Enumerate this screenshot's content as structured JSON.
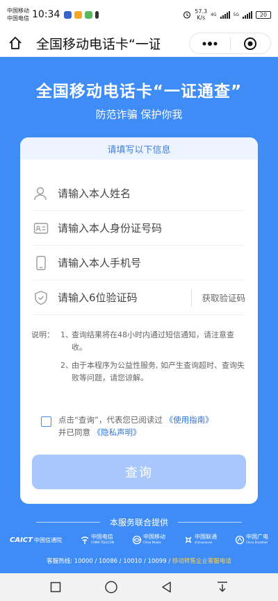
{
  "status": {
    "carrier1": "中国移动",
    "carrier2": "中国电信",
    "time": "10:34",
    "speed_value": "57.3",
    "speed_unit": "K/s",
    "net1": "4G",
    "net2": "5G",
    "battery": "20"
  },
  "nav": {
    "title": "全国移动电话卡“一证通查”",
    "more_icon": "more-dots-icon",
    "close_icon": "target-close-icon"
  },
  "hero": {
    "title": "全国移动电话卡“一证通查”",
    "subtitle": "防范诈骗 保护你我"
  },
  "form": {
    "header": "请填写以下信息",
    "name_placeholder": "请输入本人姓名",
    "id_placeholder": "请输入本人身份证号码",
    "phone_placeholder": "请输入本人手机号",
    "code_placeholder": "请输入6位验证码",
    "get_code": "获取验证码"
  },
  "notes": {
    "label": "说明：",
    "items": [
      {
        "num": "1、",
        "text": "查询结果将在48小时内通过短信通知，请注意查收。"
      },
      {
        "num": "2、",
        "text": "由于本程序为公益性服务, 如产生查询超时、查询失败等问题，请您谅解。"
      }
    ]
  },
  "agreement": {
    "prefix": "点击“查询”，代表您已阅读过 ",
    "link1": "《使用指南》",
    "middle": "并已同意 ",
    "link2": "《隐私声明》"
  },
  "query_button": "查询",
  "footer": {
    "provided_by": "本服务联合提供",
    "logos": [
      {
        "name": "CAICT",
        "cn": "中国信通院"
      },
      {
        "name": "中国电信",
        "cn": "CHINA TELECOM"
      },
      {
        "name": "中国移动",
        "cn": "China Mobile"
      },
      {
        "name": "中国联通",
        "cn": "chinaunicom"
      },
      {
        "name": "中国广电",
        "cn": "China Broadnet"
      }
    ],
    "hotline": "客服热线: 10000 / 10086 / 10010 / 10099 / ",
    "hotline_link": "移动转售企业客服电话"
  },
  "colors": {
    "primary": "#3f8cf6",
    "button_disabled": "#a8c8fb",
    "link": "#2f73d8"
  }
}
